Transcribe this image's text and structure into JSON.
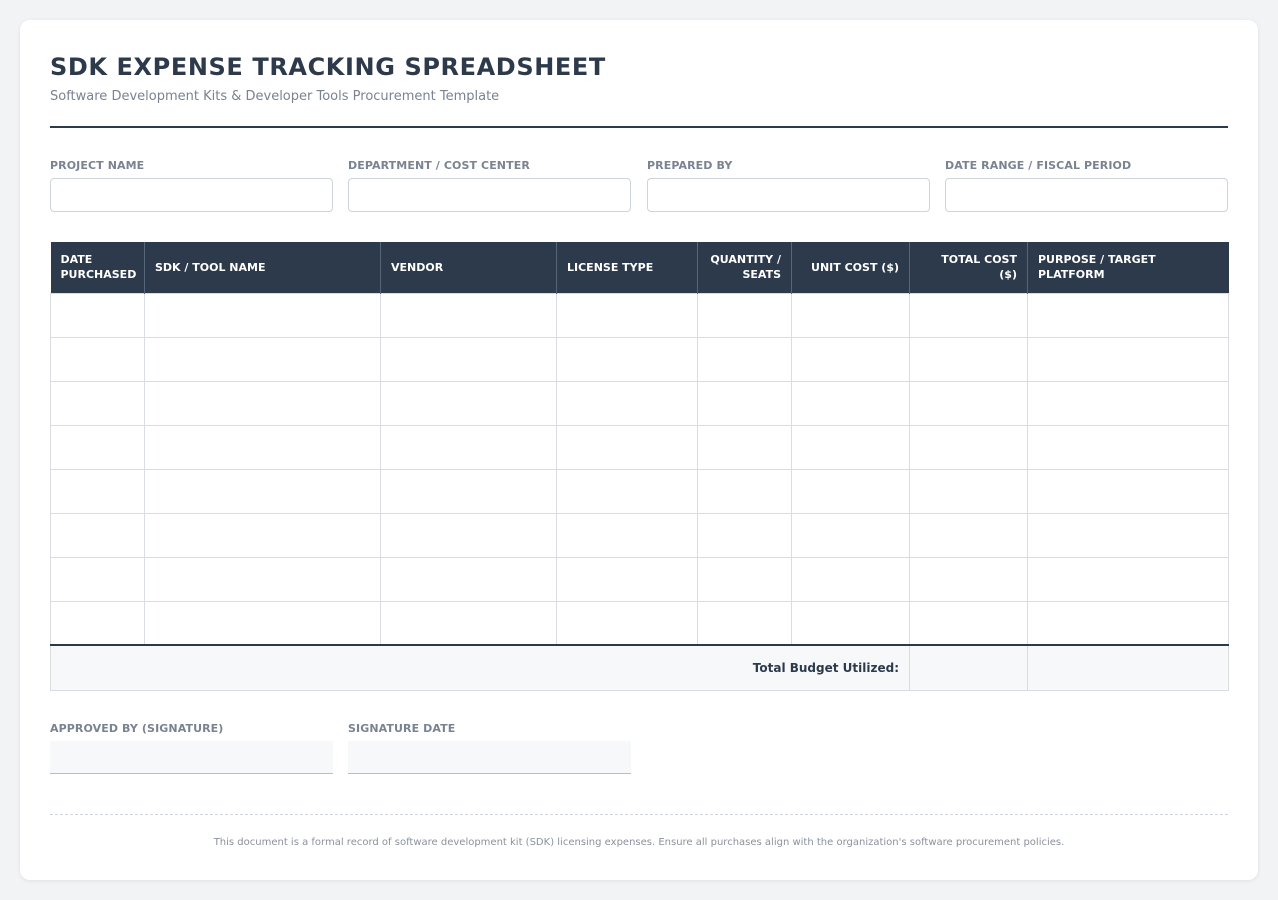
{
  "header": {
    "title": "SDK EXPENSE TRACKING SPREADSHEET",
    "subtitle": "Software Development Kits & Developer Tools Procurement Template"
  },
  "meta_fields": [
    {
      "label": "PROJECT NAME",
      "value": ""
    },
    {
      "label": "DEPARTMENT / COST CENTER",
      "value": ""
    },
    {
      "label": "PREPARED BY",
      "value": ""
    },
    {
      "label": "DATE RANGE / FISCAL PERIOD",
      "value": ""
    }
  ],
  "table": {
    "columns": [
      "DATE PURCHASED",
      "SDK / TOOL NAME",
      "VENDOR",
      "LICENSE TYPE",
      "QUANTITY / SEATS",
      "UNIT COST ($)",
      "TOTAL COST ($)",
      "PURPOSE / TARGET PLATFORM"
    ],
    "rows": [
      [
        "",
        "",
        "",
        "",
        "",
        "",
        "",
        ""
      ],
      [
        "",
        "",
        "",
        "",
        "",
        "",
        "",
        ""
      ],
      [
        "",
        "",
        "",
        "",
        "",
        "",
        "",
        ""
      ],
      [
        "",
        "",
        "",
        "",
        "",
        "",
        "",
        ""
      ],
      [
        "",
        "",
        "",
        "",
        "",
        "",
        "",
        ""
      ],
      [
        "",
        "",
        "",
        "",
        "",
        "",
        "",
        ""
      ],
      [
        "",
        "",
        "",
        "",
        "",
        "",
        "",
        ""
      ],
      [
        "",
        "",
        "",
        "",
        "",
        "",
        "",
        ""
      ]
    ],
    "total_label": "Total Budget Utilized:",
    "total_value": ""
  },
  "signatures": [
    {
      "label": "APPROVED BY (SIGNATURE)",
      "value": ""
    },
    {
      "label": "SIGNATURE DATE",
      "value": ""
    }
  ],
  "footer": {
    "note": "This document is a formal record of software development kit (SDK) licensing expenses. Ensure all purchases align with the organization's software procurement policies."
  }
}
